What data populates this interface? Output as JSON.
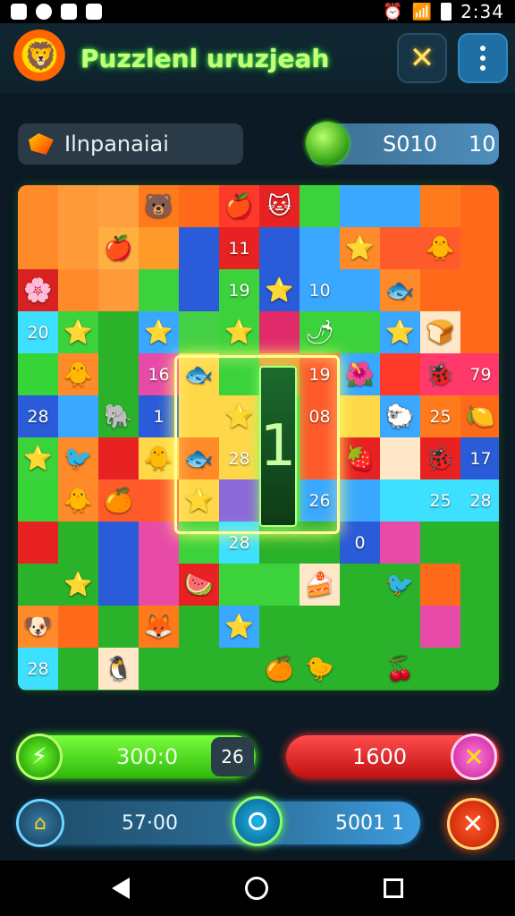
{
  "status": {
    "time": "2:34"
  },
  "header": {
    "title": "Puzzlenl uruzjeah"
  },
  "player": {
    "name": "Ilnpanaiai",
    "score_a": "S010",
    "score_b": "10"
  },
  "board": {
    "numbers": [
      {
        "label": "11"
      },
      {
        "label": "19"
      },
      {
        "label": "10"
      },
      {
        "label": "20"
      },
      {
        "label": "16"
      },
      {
        "label": "19"
      },
      {
        "label": "79"
      },
      {
        "label": "28"
      },
      {
        "label": "1"
      },
      {
        "label": "08"
      },
      {
        "label": "25"
      },
      {
        "label": "28"
      },
      {
        "label": "17"
      },
      {
        "label": "26"
      },
      {
        "label": "28"
      },
      {
        "label": "25"
      },
      {
        "label": "28"
      },
      {
        "label": "0"
      },
      {
        "label": "28"
      }
    ],
    "highlight_bar": "1"
  },
  "bottom": {
    "green_value": "300:0",
    "green_tag": "26",
    "red_value": "1600",
    "blue_value_1": "57·00",
    "blue_value_2": "5001 1"
  },
  "icons": {
    "menu": "more-vertical-icon",
    "close": "close-icon",
    "red_action": "cross-icon"
  }
}
